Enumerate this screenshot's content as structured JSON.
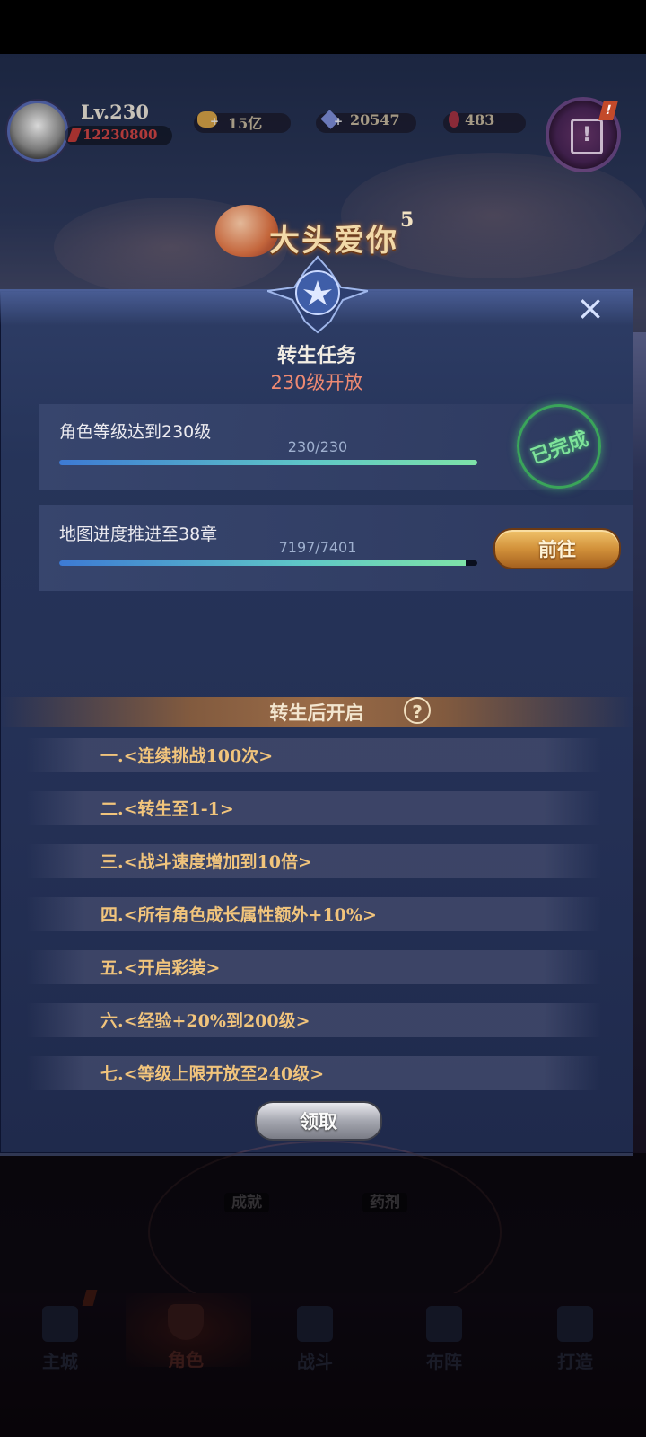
{
  "hud": {
    "level": "Lv.230",
    "power": "12230800",
    "gold": "15亿",
    "gems": "20547",
    "rubies": "483",
    "plus": "+",
    "alert": "!"
  },
  "banner": {
    "text": "大头爱你",
    "sup": "5"
  },
  "modal": {
    "title": "转生任务",
    "subtitle": "230级开放",
    "close_label": "×",
    "tasks": [
      {
        "label": "角色等级达到230级",
        "progress_text": "230/230",
        "progress": 1.0,
        "status": "已完成"
      },
      {
        "label": "地图进度推进至38章",
        "progress_text": "7197/7401",
        "progress": 0.9724,
        "action": "前往"
      }
    ],
    "unlock_title": "转生后开启",
    "help": "?",
    "perks": [
      "一.<连续挑战100次>",
      "二.<转生至1-1>",
      "三.<战斗速度增加到10倍>",
      "四.<所有角色成长属性额外+10%>",
      "五.<开启彩装>",
      "六.<经验+20%到200级>",
      "七.<等级上限开放至240级>"
    ],
    "claim_label": "领取"
  },
  "under": {
    "achievement": "成就",
    "potion": "药剂"
  },
  "nav": [
    {
      "label": "主城",
      "active": false
    },
    {
      "label": "角色",
      "active": true
    },
    {
      "label": "战斗",
      "active": false
    },
    {
      "label": "布阵",
      "active": false
    },
    {
      "label": "打造",
      "active": false
    }
  ],
  "colors": {
    "accent_gold": "#f1c47c",
    "complete_green": "#7ee39a",
    "subtitle_red": "#ef8a72"
  }
}
